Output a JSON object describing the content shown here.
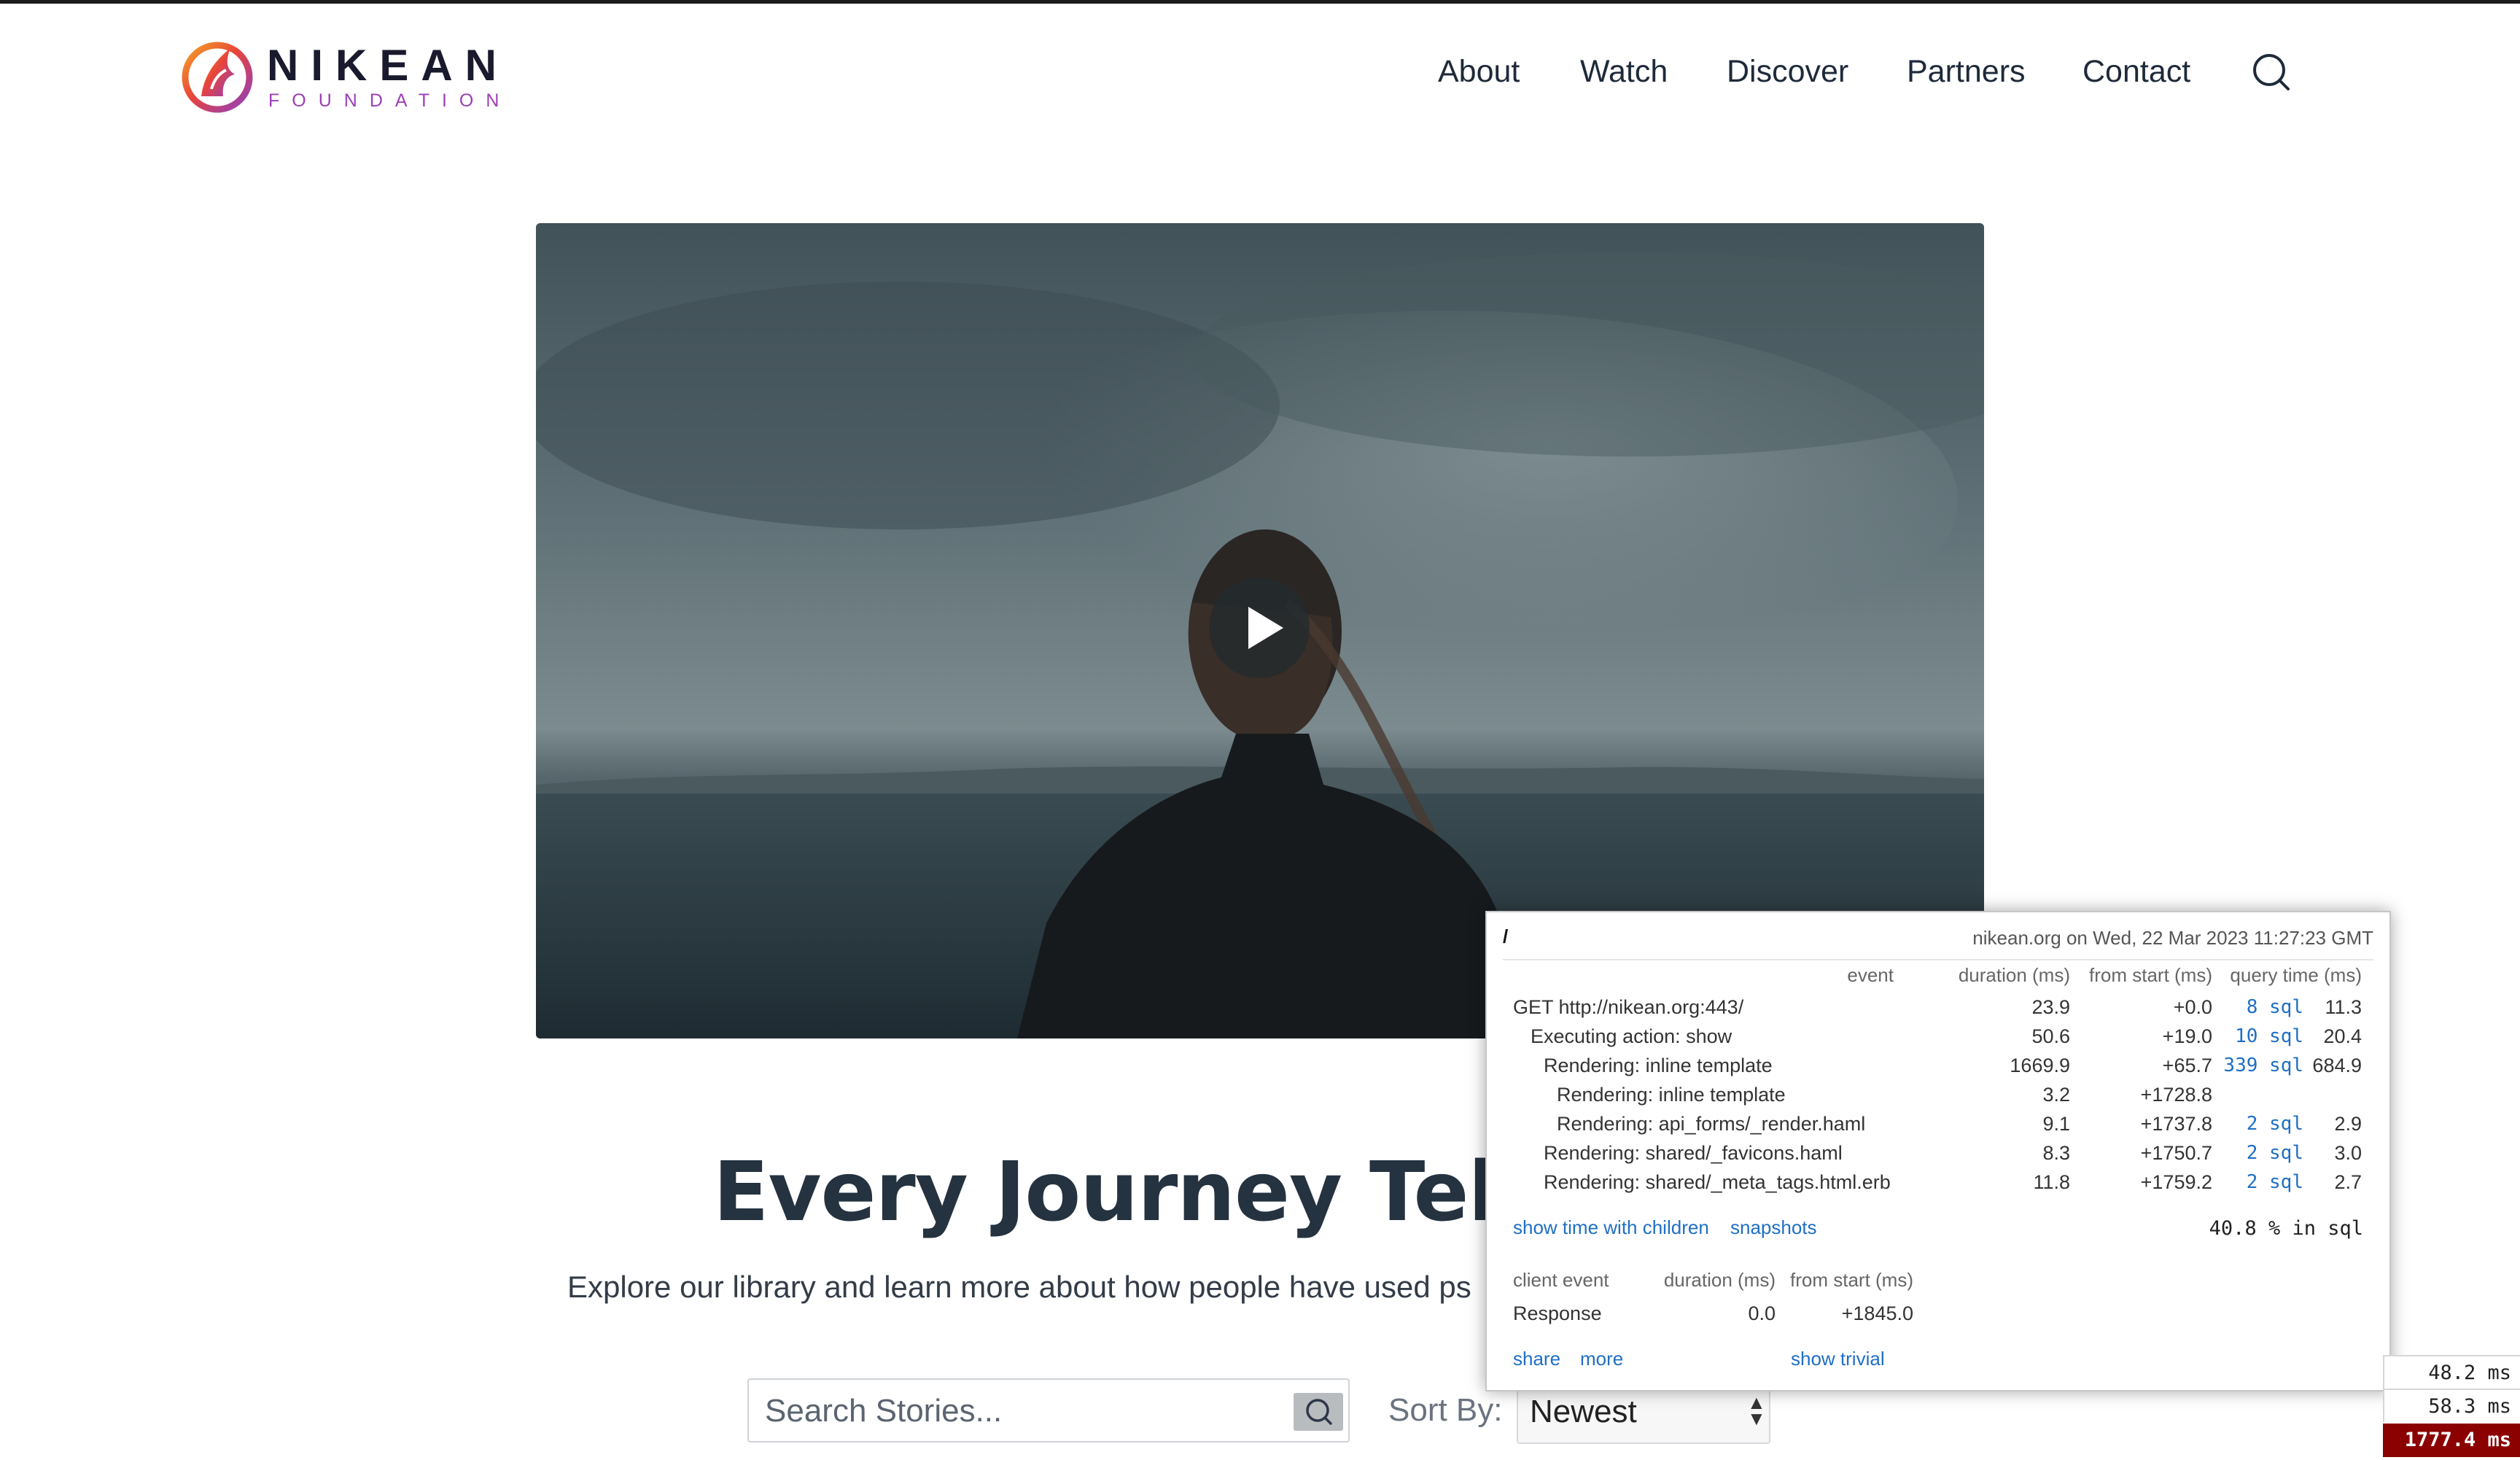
{
  "header": {
    "logo_name": "NIKEAN",
    "logo_sub": "FOUNDATION",
    "nav": [
      "About",
      "Watch",
      "Discover",
      "Partners",
      "Contact"
    ]
  },
  "hero": {
    "play_icon": "play-icon"
  },
  "main": {
    "heading": "Every Journey Tells",
    "intro": "Explore our library and learn more about how people have used ps"
  },
  "search": {
    "placeholder": "Search Stories...",
    "sort_label": "Sort By:",
    "sort_value": "Newest"
  },
  "profiler": {
    "path": "/",
    "host_time": "nikean.org on Wed, 22 Mar 2023 11:27:23 GMT",
    "columns": [
      "event",
      "duration (ms)",
      "from start (ms)",
      "query time (ms)"
    ],
    "rows": [
      {
        "event": "GET http://nikean.org:443/",
        "duration": "23.9",
        "from_start": "+0.0",
        "sql": "8 sql",
        "query_time": "11.3"
      },
      {
        "event": "Executing action: show",
        "duration": "50.6",
        "from_start": "+19.0",
        "sql": "10 sql",
        "query_time": "20.4"
      },
      {
        "event": "Rendering: inline template",
        "duration": "1669.9",
        "from_start": "+65.7",
        "sql": "339 sql",
        "query_time": "684.9"
      },
      {
        "event": "Rendering: inline template",
        "duration": "3.2",
        "from_start": "+1728.8",
        "sql": "",
        "query_time": ""
      },
      {
        "event": "Rendering: api_forms/_render.haml",
        "duration": "9.1",
        "from_start": "+1737.8",
        "sql": "2 sql",
        "query_time": "2.9"
      },
      {
        "event": "Rendering: shared/_favicons.haml",
        "duration": "8.3",
        "from_start": "+1750.7",
        "sql": "2 sql",
        "query_time": "3.0"
      },
      {
        "event": "Rendering: shared/_meta_tags.html.erb",
        "duration": "11.8",
        "from_start": "+1759.2",
        "sql": "2 sql",
        "query_time": "2.7"
      }
    ],
    "show_children_link": "show time with children",
    "snapshots_link": "snapshots",
    "sql_percent": "40.8 % in sql",
    "client_columns": [
      "client event",
      "duration (ms)",
      "from start (ms)"
    ],
    "client_rows": [
      {
        "event": "Response",
        "duration": "0.0",
        "from_start": "+1845.0"
      }
    ],
    "share_link": "share",
    "more_link": "more",
    "trivial_link": "show trivial"
  },
  "timings": [
    "48.2 ms",
    "58.3 ms",
    "1777.4 ms"
  ]
}
